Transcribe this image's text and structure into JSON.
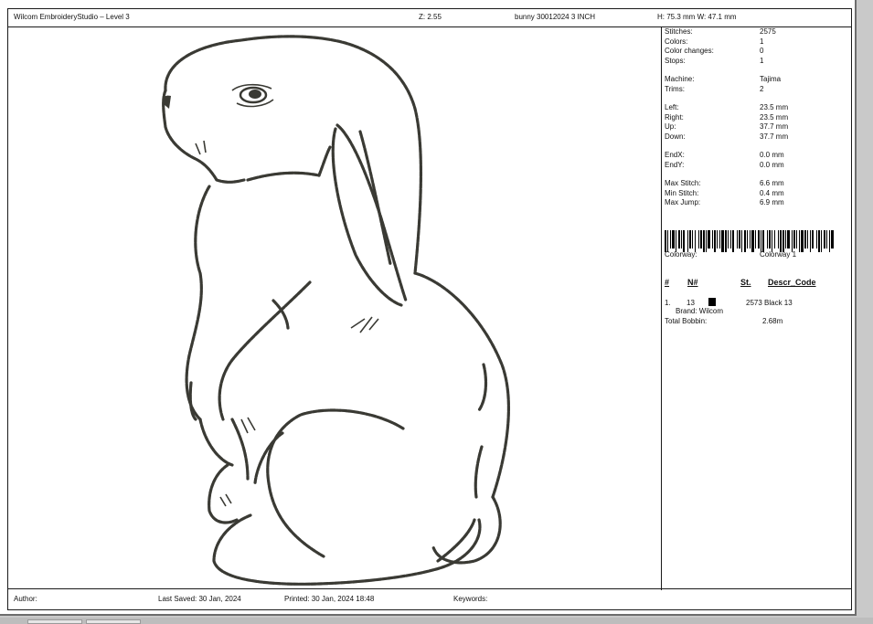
{
  "header": {
    "app_title": "Wilcom EmbroideryStudio – Level 3",
    "zoom": "Z: 2.55",
    "design_name": "bunny 30012024 3 INCH",
    "dimensions": "H: 75.3 mm   W: 47.1 mm"
  },
  "info": {
    "stats": [
      {
        "label": "Stitches:",
        "value": "2575"
      },
      {
        "label": "Colors:",
        "value": "1"
      },
      {
        "label": "Color changes:",
        "value": "0"
      },
      {
        "label": "Stops:",
        "value": "1"
      },
      {
        "label": "Machine:",
        "value": "Tajima"
      },
      {
        "label": "Trims:",
        "value": "2"
      },
      {
        "label": "Left:",
        "value": "23.5 mm"
      },
      {
        "label": "Right:",
        "value": "23.5 mm"
      },
      {
        "label": "Up:",
        "value": "37.7 mm"
      },
      {
        "label": "Down:",
        "value": "37.7 mm"
      },
      {
        "label": "EndX:",
        "value": "0.0 mm"
      },
      {
        "label": "EndY:",
        "value": "0.0 mm"
      },
      {
        "label": "Max Stitch:",
        "value": "6.6 mm"
      },
      {
        "label": "Min Stitch:",
        "value": "0.4 mm"
      },
      {
        "label": "Max Jump:",
        "value": "6.9 mm"
      }
    ],
    "colorway_label": "Colorway:",
    "colorway_value": "Colorway 1",
    "table_headers": {
      "num": "#",
      "n": "N#",
      "st": "St.",
      "descr": "Descr_Code"
    },
    "color_row": {
      "index": "1.",
      "n": "13",
      "swatch_color": "#000000",
      "stitches": "2573",
      "descr": "Black 13",
      "brand": "Brand: Wilcom"
    },
    "total_bobbin_label": "Total Bobbin:",
    "total_bobbin_value": "2.68m"
  },
  "footer": {
    "author": "Author:",
    "last_saved": "Last Saved: 30 Jan, 2024",
    "printed": "Printed: 30 Jan, 2024 18:48",
    "keywords": "Keywords:"
  },
  "colors": {
    "thread": "#3a3a34",
    "border": "#1a1a1a"
  }
}
